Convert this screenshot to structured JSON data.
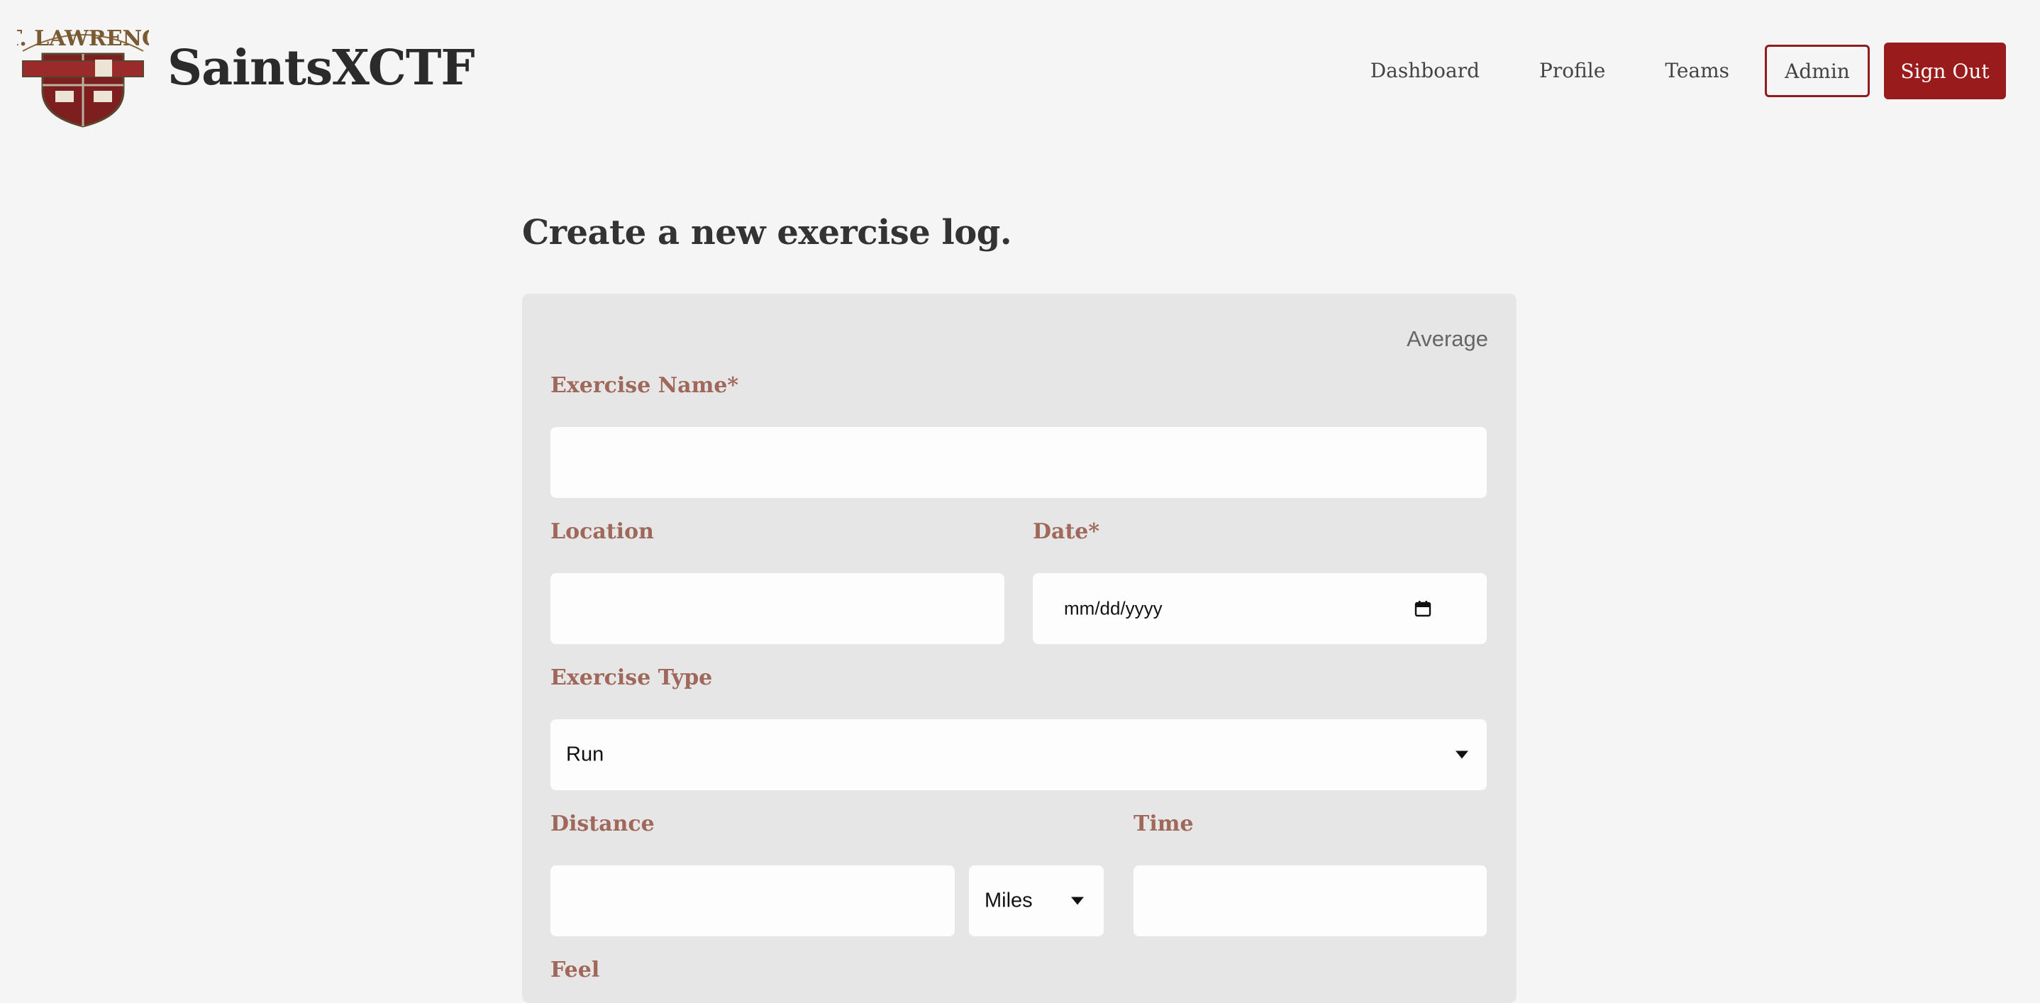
{
  "header": {
    "logo_alt": "St. Lawrence Cross Country Track & Field",
    "logo_text": "ST. LAWRENCE",
    "site_title": "SaintsXCTF",
    "nav": {
      "dashboard": "Dashboard",
      "profile": "Profile",
      "teams": "Teams",
      "admin": "Admin",
      "sign_out": "Sign Out"
    }
  },
  "main": {
    "heading": "Create a new exercise log.",
    "form": {
      "feel_indicator": "Average",
      "exercise_name": {
        "label": "Exercise Name*",
        "value": ""
      },
      "location": {
        "label": "Location",
        "value": ""
      },
      "date": {
        "label": "Date*",
        "placeholder": "mm/dd/yyyy"
      },
      "exercise_type": {
        "label": "Exercise Type",
        "selected": "Run"
      },
      "distance": {
        "label": "Distance",
        "value": "",
        "unit_selected": "Miles"
      },
      "time": {
        "label": "Time",
        "value": ""
      },
      "feel": {
        "label": "Feel"
      }
    }
  },
  "colors": {
    "brand_red": "#991b1b",
    "label_brown": "#a0685a",
    "card_bg": "#e6e6e6",
    "page_bg": "#f5f5f5"
  }
}
